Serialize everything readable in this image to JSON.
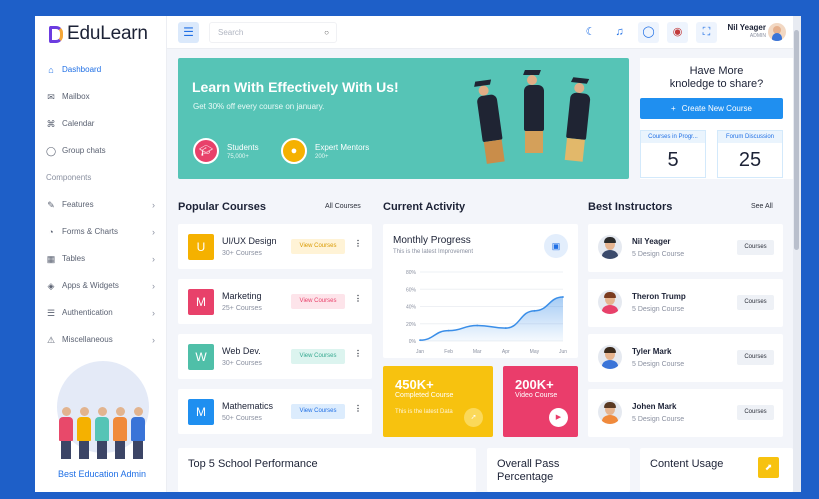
{
  "app": {
    "name": "EduLearn"
  },
  "sidebar": {
    "items": [
      {
        "label": "Dashboard",
        "icon": "home-icon",
        "active": true
      },
      {
        "label": "Mailbox",
        "icon": "mail-icon"
      },
      {
        "label": "Calendar",
        "icon": "command-icon"
      },
      {
        "label": "Group chats",
        "icon": "chat-icon"
      }
    ],
    "section": "Components",
    "components": [
      {
        "label": "Features",
        "icon": "edit-icon"
      },
      {
        "label": "Forms & Charts",
        "icon": "pie-chart-icon"
      },
      {
        "label": "Tables",
        "icon": "grid-icon"
      },
      {
        "label": "Apps & Widgets",
        "icon": "layers-icon"
      },
      {
        "label": "Authentication",
        "icon": "database-icon"
      },
      {
        "label": "Miscellaneous",
        "icon": "alert-triangle-icon"
      }
    ],
    "promo_text": "Best Education Admin"
  },
  "header": {
    "search_placeholder": "Search",
    "user_name": "Nil Yeager",
    "user_role": "ADMIN"
  },
  "hero": {
    "title": "Learn With Effectively With Us!",
    "subtitle": "Get 30% off every course on january.",
    "stats": [
      {
        "label": "Students",
        "value": "75,000+"
      },
      {
        "label": "Expert Mentors",
        "value": "200+"
      }
    ]
  },
  "knowledge": {
    "title_line1": "Have More",
    "title_line2": "knoledge to share?",
    "button": "Create New Course",
    "courses_label": "Courses in Progr...",
    "courses_value": "5",
    "forum_label": "Forum Discussion",
    "forum_value": "25"
  },
  "popular": {
    "title": "Popular Courses",
    "link": "All Courses",
    "items": [
      {
        "letter": "U",
        "name": "UI/UX Design",
        "count": "30+ Courses",
        "button": "View Courses",
        "color": "#f5b100"
      },
      {
        "letter": "M",
        "name": "Marketing",
        "count": "25+ Courses",
        "button": "View Courses",
        "color": "#e8416a"
      },
      {
        "letter": "W",
        "name": "Web Dev.",
        "count": "30+ Courses",
        "button": "View Courses",
        "color": "#4fbfa8"
      },
      {
        "letter": "M",
        "name": "Mathematics",
        "count": "50+ Courses",
        "button": "View Courses",
        "color": "#1f8ff0"
      }
    ]
  },
  "activity": {
    "title": "Current Activity",
    "progress_title": "Monthly Progress",
    "progress_sub": "This is the latest Improvement",
    "stat1_value": "450K+",
    "stat1_label": "Completed Course",
    "stat1_note": "This is the latest Data",
    "stat2_value": "200K+",
    "stat2_label": "Video Course"
  },
  "chart_data": {
    "type": "area",
    "categories": [
      "Jan",
      "Feb",
      "Mar",
      "Apr",
      "May",
      "Jun"
    ],
    "series": [
      {
        "values": [
          1,
          12,
          18,
          15,
          35,
          51
        ]
      }
    ],
    "yticks": [
      "0%",
      "20%",
      "40%",
      "60%",
      "80%"
    ],
    "ylim": [
      0,
      80
    ],
    "color": "#3a8ee8"
  },
  "instructors": {
    "title": "Best Instructors",
    "link": "See All",
    "items": [
      {
        "name": "Nil Yeager",
        "count": "5 Design Course",
        "button": "Courses"
      },
      {
        "name": "Theron Trump",
        "count": "5 Design Course",
        "button": "Courses"
      },
      {
        "name": "Tyler Mark",
        "count": "5 Design Course",
        "button": "Courses"
      },
      {
        "name": "Johen Mark",
        "count": "5 Design Course",
        "button": "Courses"
      }
    ]
  },
  "bottom": {
    "school": "Top 5 School Performance",
    "pass_line1": "Overall Pass",
    "pass_line2": "Percentage",
    "content": "Content Usage"
  }
}
